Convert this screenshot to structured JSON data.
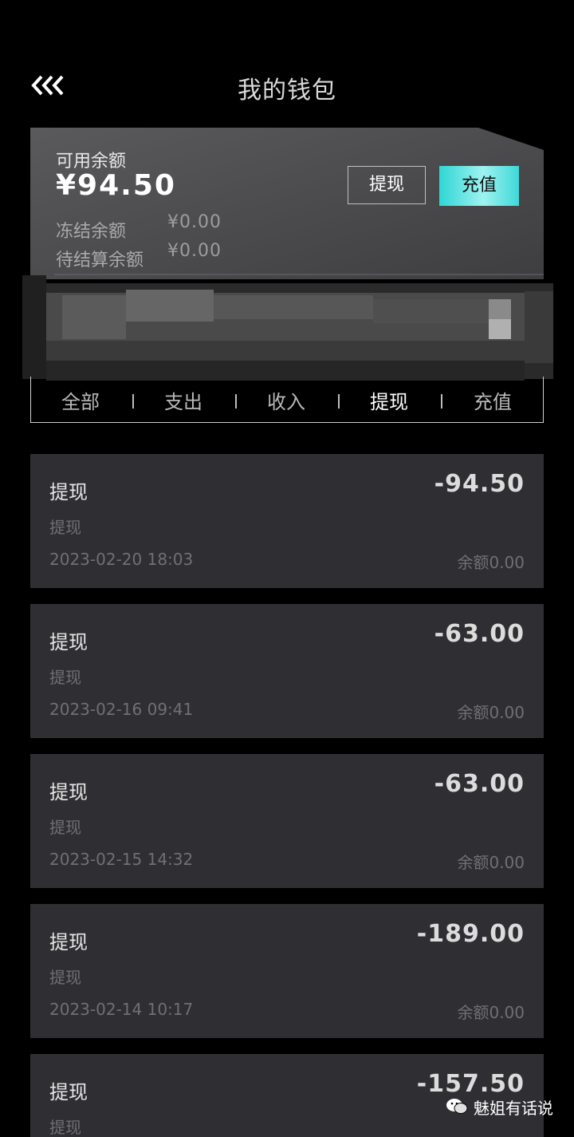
{
  "header": {
    "title": "我的钱包",
    "back_icon": "triple-chevron-left-icon"
  },
  "wallet": {
    "available_label": "可用余额",
    "available_amount": "¥94.50",
    "frozen_label": "冻结余额",
    "frozen_value": "¥0.00",
    "pending_label": "待结算余额",
    "pending_value": "¥0.00",
    "withdraw_label": "提现",
    "recharge_label": "充值",
    "recharge_color": "#5ce3e0"
  },
  "tabs": [
    {
      "label": "全部"
    },
    {
      "label": "支出"
    },
    {
      "label": "收入"
    },
    {
      "label": "提现",
      "active": true
    },
    {
      "label": "充值"
    }
  ],
  "transactions": [
    {
      "title": "提现",
      "subtitle": "提现",
      "time": "2023-02-20 18:03",
      "amount": "-94.50",
      "balance": "余额0.00"
    },
    {
      "title": "提现",
      "subtitle": "提现",
      "time": "2023-02-16 09:41",
      "amount": "-63.00",
      "balance": "余额0.00"
    },
    {
      "title": "提现",
      "subtitle": "提现",
      "time": "2023-02-15 14:32",
      "amount": "-63.00",
      "balance": "余额0.00"
    },
    {
      "title": "提现",
      "subtitle": "提现",
      "time": "2023-02-14 10:17",
      "amount": "-189.00",
      "balance": "余额0.00"
    },
    {
      "title": "提现",
      "subtitle": "提现",
      "time": "",
      "amount": "-157.50",
      "balance": ""
    }
  ],
  "watermark": {
    "text": "魅姐有话说",
    "icon": "wechat-icon"
  }
}
